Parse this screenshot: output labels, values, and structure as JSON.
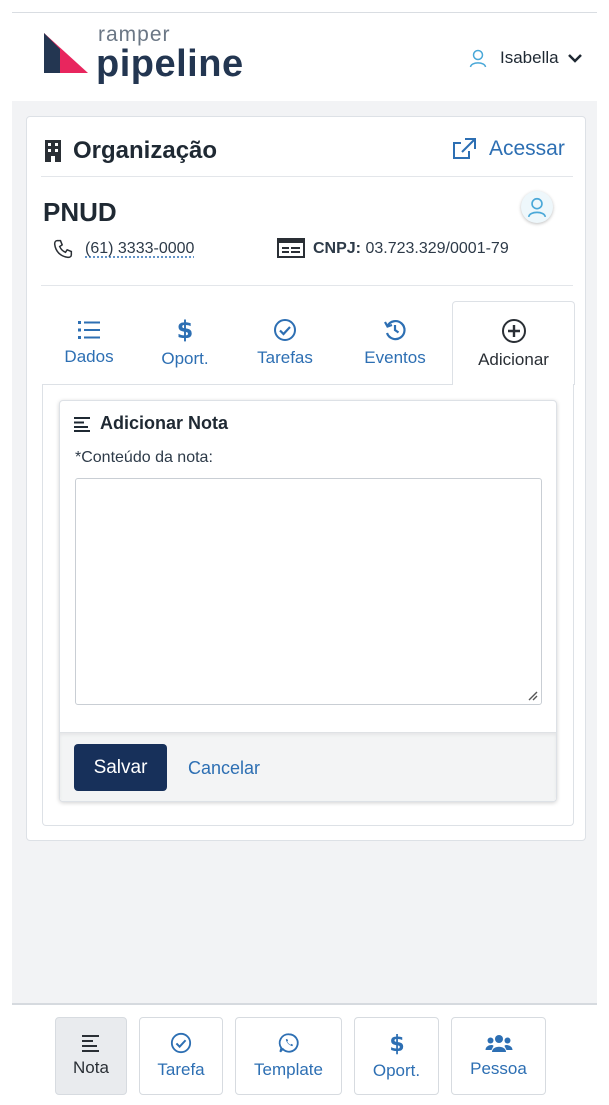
{
  "header": {
    "brand_top": "ramper",
    "brand_main": "pipeline",
    "user_name": "Isabella",
    "brand_color": "#e8265e",
    "brand_dark": "#233651"
  },
  "organization": {
    "section_title": "Organização",
    "access_label": "Acessar",
    "name": "PNUD",
    "phone": "(61) 3333-0000",
    "cnpj_label": "CNPJ:",
    "cnpj_value": "03.723.329/0001-79"
  },
  "tabs": [
    {
      "label": "Dados",
      "icon": "list-icon",
      "active": false
    },
    {
      "label": "Oport.",
      "icon": "dollar-icon",
      "active": false
    },
    {
      "label": "Tarefas",
      "icon": "check-circle-icon",
      "active": false
    },
    {
      "label": "Eventos",
      "icon": "history-icon",
      "active": false
    },
    {
      "label": "Adicionar",
      "icon": "plus-circle-icon",
      "active": true
    }
  ],
  "note_form": {
    "title": "Adicionar Nota",
    "content_label": "*Conteúdo da nota:",
    "content_value": "",
    "save_label": "Salvar",
    "cancel_label": "Cancelar"
  },
  "bottom_bar": [
    {
      "label": "Nota",
      "icon": "align-left-icon",
      "active": true
    },
    {
      "label": "Tarefa",
      "icon": "check-circle-icon",
      "active": false
    },
    {
      "label": "Template",
      "icon": "whatsapp-icon",
      "active": false
    },
    {
      "label": "Oport.",
      "icon": "dollar-icon",
      "active": false
    },
    {
      "label": "Pessoa",
      "icon": "users-icon",
      "active": false
    }
  ],
  "colors": {
    "accent": "#2d6fb3",
    "primary_button": "#17305a",
    "background": "#f2f3f5"
  }
}
